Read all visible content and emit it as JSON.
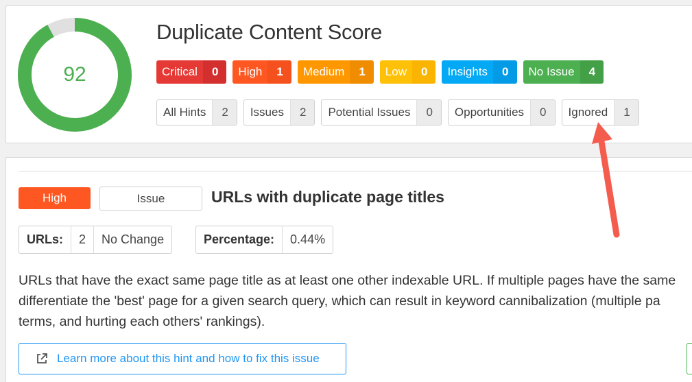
{
  "score": {
    "value": "92",
    "fraction": 0.92,
    "title": "Duplicate Content Score",
    "gauge_color": "#4caf50",
    "track_color": "#e0e0e0"
  },
  "severities": [
    {
      "label": "Critical",
      "count": "0",
      "color": "#e53935",
      "count_color": "#d32f2f"
    },
    {
      "label": "High",
      "count": "1",
      "color": "#ff5722",
      "count_color": "#f4511e"
    },
    {
      "label": "Medium",
      "count": "1",
      "color": "#ff9800",
      "count_color": "#f08c00"
    },
    {
      "label": "Low",
      "count": "0",
      "color": "#ffc107",
      "count_color": "#fbb400"
    },
    {
      "label": "Insights",
      "count": "0",
      "color": "#03a9f4",
      "count_color": "#039be5"
    },
    {
      "label": "No Issue",
      "count": "4",
      "color": "#4caf50",
      "count_color": "#43a047"
    }
  ],
  "filters": [
    {
      "label": "All Hints",
      "count": "2"
    },
    {
      "label": "Issues",
      "count": "2"
    },
    {
      "label": "Potential Issues",
      "count": "0"
    },
    {
      "label": "Opportunities",
      "count": "0"
    },
    {
      "label": "Ignored",
      "count": "1"
    }
  ],
  "arrow_color": "#f45c4e",
  "hint": {
    "severity": "High",
    "type": "Issue",
    "title": "URLs with duplicate page titles",
    "urls_label": "URLs:",
    "urls_value": "2",
    "urls_change": "No Change",
    "pct_label": "Percentage:",
    "pct_value": "0.44%",
    "description": "URLs that have the exact same page title as at least one other indexable URL. If multiple pages have the same\ndifferentiate the 'best' page for a given search query, which can result in keyword cannibalization (multiple pa\nterms, and hurting each others' rankings).",
    "learn_more": "Learn more about this hint and how to fix this issue",
    "learn_more_icon": "external-link-icon"
  }
}
